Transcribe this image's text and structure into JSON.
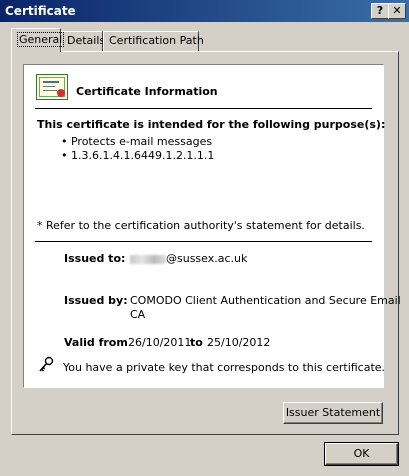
{
  "window": {
    "title": "Certificate",
    "help_button": "?",
    "close_button": "✕"
  },
  "tabs": [
    {
      "label": "General",
      "active": true
    },
    {
      "label": "Details",
      "active": false
    },
    {
      "label": "Certification Path",
      "active": false
    }
  ],
  "info": {
    "heading": "Certificate Information",
    "purpose_title": "This certificate is intended for the following purpose(s):",
    "purposes": [
      "• Protects e-mail messages",
      "• 1.3.6.1.4.1.6449.1.2.1.1.1"
    ],
    "refer_note": "* Refer to the certification authority's statement for details.",
    "issued_to_label": "Issued to:",
    "issued_to_value": "@sussex.ac.uk",
    "issued_by_label": "Issued by:",
    "issued_by_line1": "COMODO Client Authentication and Secure Email",
    "issued_by_line2": "CA",
    "valid_from_label": "Valid from",
    "valid_from_value": "26/10/2011",
    "valid_to_label": "to",
    "valid_to_value": "25/10/2012",
    "private_key_note": "You have a private key that corresponds to this certificate."
  },
  "buttons": {
    "issuer_statement": "Issuer Statement",
    "ok": "OK"
  }
}
